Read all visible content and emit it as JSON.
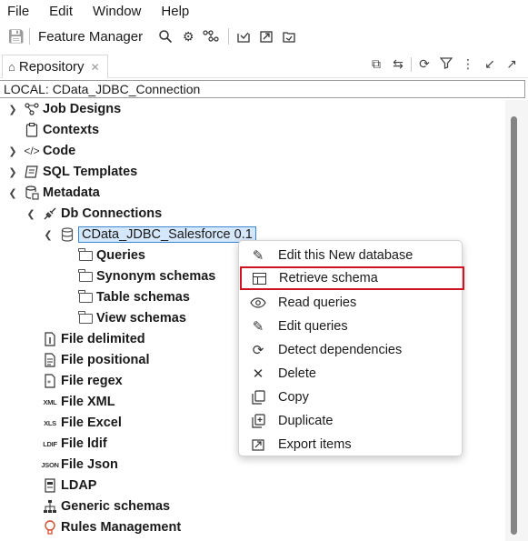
{
  "menubar": {
    "items": [
      "File",
      "Edit",
      "Window",
      "Help"
    ]
  },
  "toolbar": {
    "save_icon": "save-icon",
    "feature_manager_label": "Feature Manager",
    "icons": [
      "search-icon",
      "gear-icon",
      "workflow-icon",
      "import-icon",
      "export-icon",
      "export-alt-icon"
    ]
  },
  "repository_tab": {
    "label": "Repository",
    "icon": "home-icon",
    "view_icons": [
      "collapse-all-icon",
      "link-icon",
      "refresh-icon",
      "filter-icon",
      "more-icon",
      "minimize-icon",
      "maximize-icon"
    ]
  },
  "path_bar": {
    "text": "LOCAL: CData_JDBC_Connection"
  },
  "tree": {
    "job_designs": "Job Designs",
    "contexts": "Contexts",
    "code": "Code",
    "sql_templates": "SQL Templates",
    "metadata": "Metadata",
    "db_connections": "Db Connections",
    "connection": "CData_JDBC_Salesforce 0.1",
    "queries": "Queries",
    "synonym_schemas": "Synonym schemas",
    "table_schemas": "Table schemas",
    "view_schemas": "View schemas",
    "file_delimited": "File delimited",
    "file_positional": "File positional",
    "file_regex": "File regex",
    "file_xml": "File XML",
    "file_excel": "File Excel",
    "file_ldif": "File ldif",
    "file_json": "File Json",
    "ldap": "LDAP",
    "generic_schemas": "Generic schemas",
    "rules_management": "Rules Management",
    "mini_icons": {
      "xml": "XML",
      "xls": "XLS",
      "ldif": "LDIF",
      "json": "JSON"
    }
  },
  "context_menu": {
    "edit_this_new_database": "Edit this New database",
    "retrieve_schema": "Retrieve schema",
    "read_queries": "Read queries",
    "edit_queries": "Edit queries",
    "detect_dependencies": "Detect dependencies",
    "delete": "Delete",
    "copy": "Copy",
    "duplicate": "Duplicate",
    "export_items": "Export items",
    "highlight_color": "#d0141f"
  },
  "colors": {
    "selection_bg": "#d5e8fb",
    "selection_border": "#3a86d9",
    "scrollbar_thumb": "#858585"
  }
}
